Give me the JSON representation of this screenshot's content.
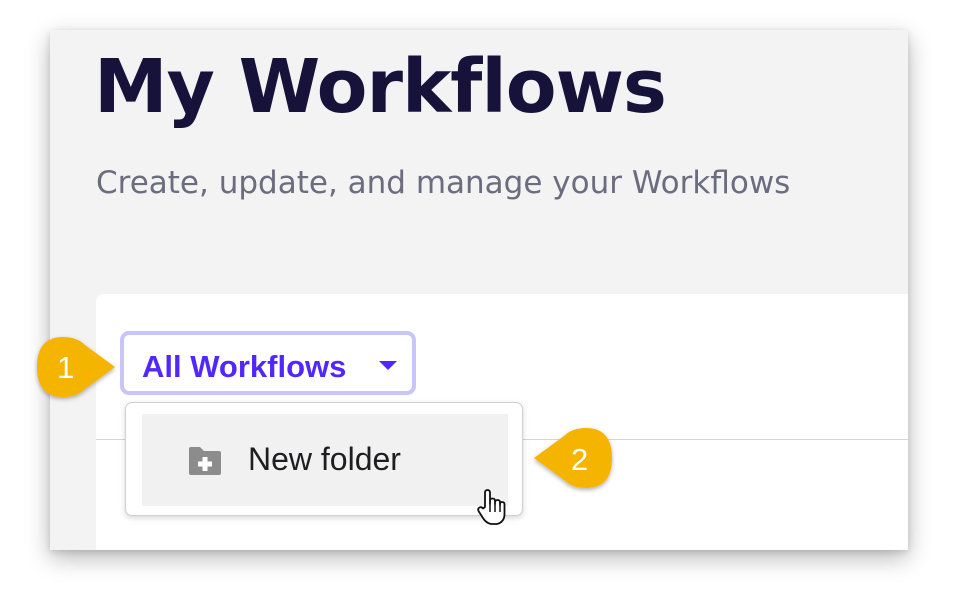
{
  "header": {
    "title": "My Workflows",
    "subtitle": "Create, update, and manage your Workflows"
  },
  "filter": {
    "selected_label": "All Workflows",
    "caret_icon": "caret-down-icon"
  },
  "dropdown_menu": {
    "items": [
      {
        "label": "New folder",
        "icon": "folder-add-icon"
      }
    ]
  },
  "callouts": [
    {
      "number": "1"
    },
    {
      "number": "2"
    }
  ],
  "colors": {
    "title": "#17123a",
    "subtitle": "#6c6c7e",
    "accent": "#5227ff",
    "accent_border": "#c9c4f9",
    "callout": "#f5b400",
    "panel_background": "#f3f3f4",
    "menu_item_hover": "#f1f1f1"
  }
}
